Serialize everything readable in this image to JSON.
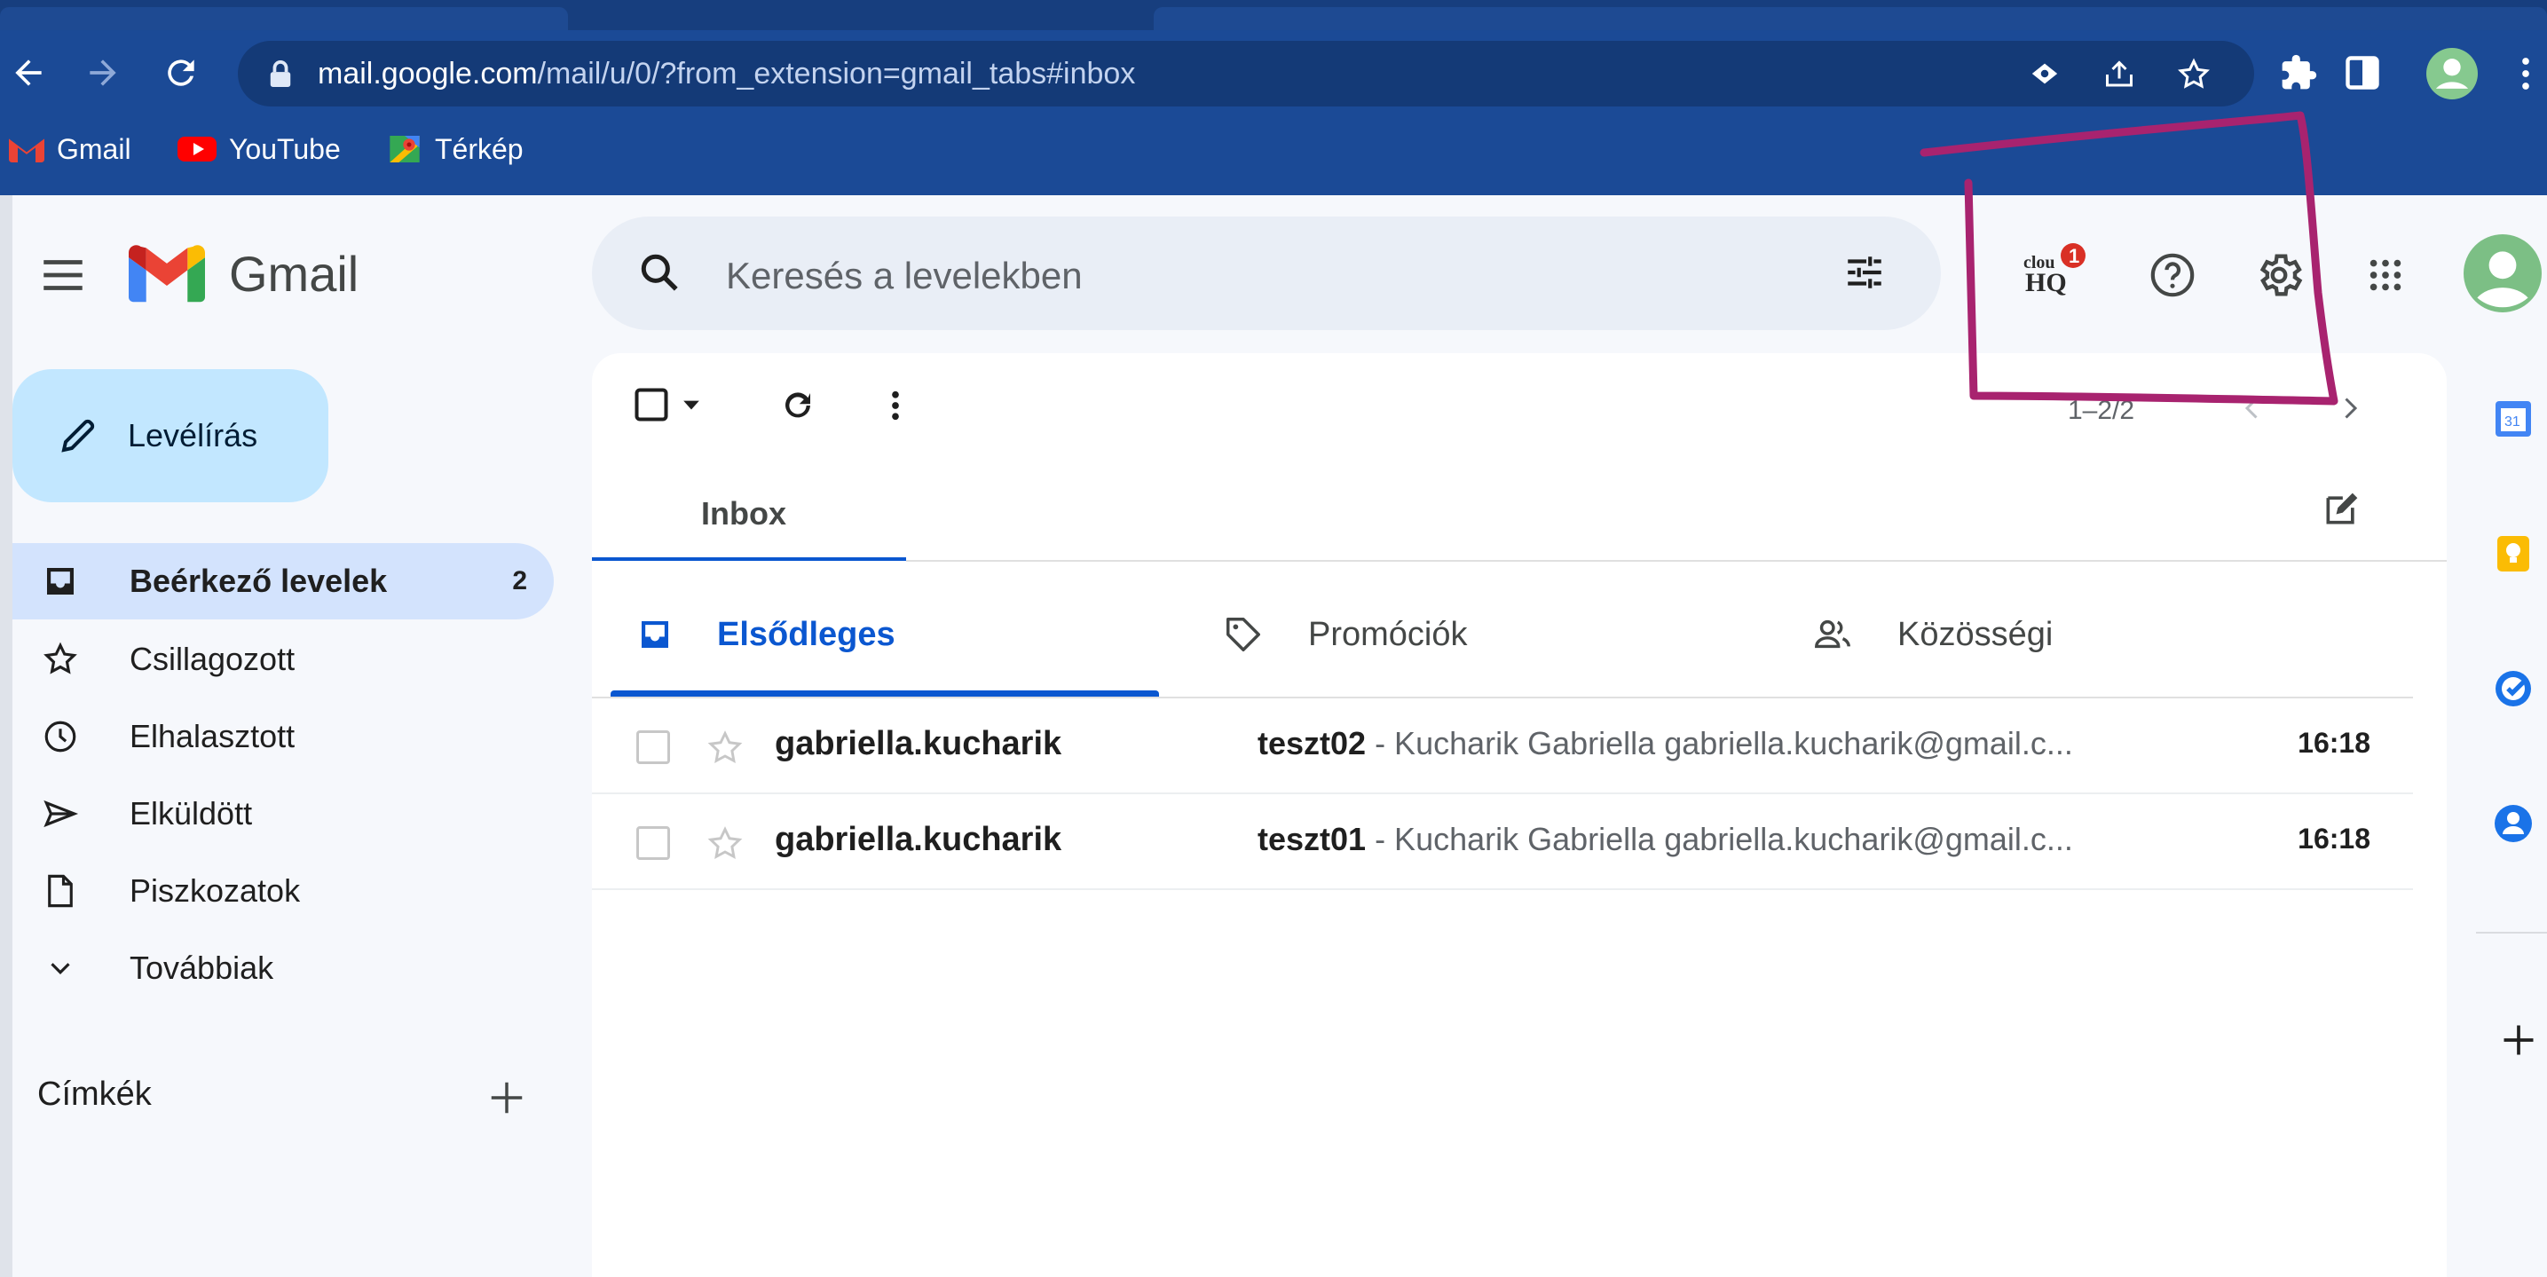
{
  "browser": {
    "url_host": "mail.google.com",
    "url_path": "/mail/u/0/?from_extension=gmail_tabs#inbox",
    "bookmarks": [
      {
        "label": "Gmail",
        "icon": "gmail-icon"
      },
      {
        "label": "YouTube",
        "icon": "youtube-icon"
      },
      {
        "label": "Térkép",
        "icon": "maps-icon"
      }
    ]
  },
  "gmail": {
    "logo_text": "Gmail",
    "search_placeholder": "Keresés a levelekben",
    "header_icons": [
      "cloudhq-icon",
      "help-icon",
      "settings-icon",
      "apps-grid-icon",
      "avatar"
    ],
    "cloudhq": {
      "text_top": "clou",
      "text_bottom": "HQ",
      "badge": "1"
    },
    "compose_label": "Levélírás",
    "nav": [
      {
        "label": "Beérkező levelek",
        "count": "2",
        "icon": "inbox-icon",
        "active": true
      },
      {
        "label": "Csillagozott",
        "count": "",
        "icon": "star-icon"
      },
      {
        "label": "Elhalasztott",
        "count": "",
        "icon": "clock-icon"
      },
      {
        "label": "Elküldött",
        "count": "",
        "icon": "send-icon"
      },
      {
        "label": "Piszkozatok",
        "count": "",
        "icon": "draft-icon"
      },
      {
        "label": "Továbbiak",
        "count": "",
        "icon": "chevron-down-icon"
      }
    ],
    "labels_title": "Címkék",
    "pager": "1–2/2",
    "inbox_tab": "Inbox",
    "categories": [
      {
        "label": "Elsődleges",
        "icon": "inbox-icon",
        "active": true
      },
      {
        "label": "Promóciók",
        "icon": "tag-icon"
      },
      {
        "label": "Közösségi",
        "icon": "people-icon"
      }
    ],
    "emails": [
      {
        "sender": "gabriella.kucharik",
        "subject": "teszt02",
        "snippet": " - Kucharik Gabriella gabriella.kucharik@gmail.c...",
        "time": "16:18"
      },
      {
        "sender": "gabriella.kucharik",
        "subject": "teszt01",
        "snippet": " - Kucharik Gabriella gabriella.kucharik@gmail.c...",
        "time": "16:18"
      }
    ]
  },
  "colors": {
    "chrome_blue": "#1b4a96",
    "gmail_blue": "#0b57d0",
    "compose_bg": "#c2e7ff",
    "annotation": "#a8236f"
  }
}
